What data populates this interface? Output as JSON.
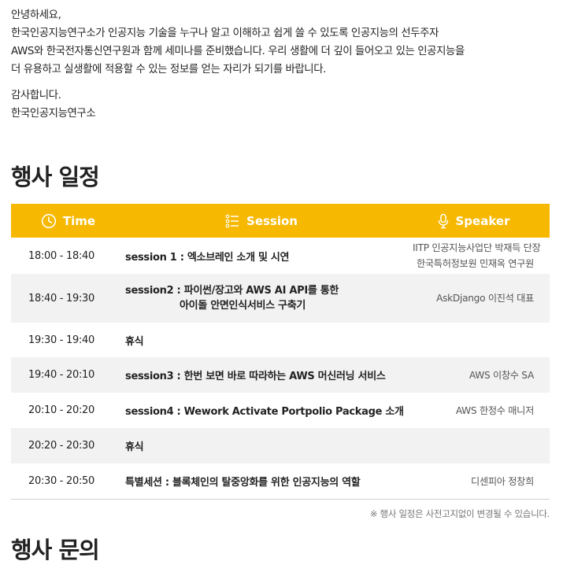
{
  "intro": {
    "lines": [
      "안녕하세요,",
      "한국인공지능연구소가 인공지능 기술을 누구나 알고 이해하고 쉽게 쓸 수 있도록 인공지능의 선두주자",
      "AWS와 한국전자통신연구원과 함께 세미나를 준비했습니다. 우리 생활에 더 깊이 들어오고 있는 인공지능을",
      "더 유용하고 실생활에 적용할 수 있는 정보를 얻는 자리가 되기를 바랍니다."
    ],
    "closing": [
      "감사합니다.",
      "한국인공지능연구소"
    ]
  },
  "schedule": {
    "heading": "행사 일정",
    "columns": {
      "time": "Time",
      "session": "Session",
      "speaker": "Speaker"
    },
    "colors": {
      "header_bg": "#f6b800",
      "header_text": "#ffffff",
      "alt_row": "#f2f2f2"
    },
    "rows": [
      {
        "time": "18:00 - 18:40",
        "session": "session 1 : 엑소브레인 소개 및 시연",
        "session_sub": "",
        "speaker": [
          "IITP 인공지능사업단 박재득 단장",
          "한국특허정보원 민재옥 연구원"
        ]
      },
      {
        "time": "18:40 - 19:30",
        "session": "session2 : 파이썬/장고와 AWS AI API를 통한",
        "session_sub": "아이돌 안면인식서비스 구축기",
        "speaker": [
          "AskDjango 이진석 대표"
        ]
      },
      {
        "time": "19:30 - 19:40",
        "session": "휴식",
        "session_sub": "",
        "speaker": []
      },
      {
        "time": "19:40 - 20:10",
        "session": "session3 : 한번 보면 바로 따라하는 AWS 머신러닝 서비스",
        "session_sub": "",
        "speaker": [
          "AWS 이창수 SA"
        ]
      },
      {
        "time": "20:10 - 20:20",
        "session": "session4 : Wework Activate Portpolio Package 소개",
        "session_sub": "",
        "speaker": [
          "AWS 한정수 매니저"
        ]
      },
      {
        "time": "20:20 - 20:30",
        "session": "휴식",
        "session_sub": "",
        "speaker": []
      },
      {
        "time": "20:30 - 20:50",
        "session": "특별세션 : 블록체인의 탈중앙화를 위한 인공지능의 역할",
        "session_sub": "",
        "speaker": [
          "디센피아 정창희"
        ]
      }
    ],
    "notice": "※ 행사 일정은 사전고지없이 변경될 수 있습니다."
  },
  "inquiry": {
    "heading": "행사 문의"
  },
  "icons": {
    "time": "clock-icon",
    "session": "list-icon",
    "speaker": "microphone-icon"
  }
}
